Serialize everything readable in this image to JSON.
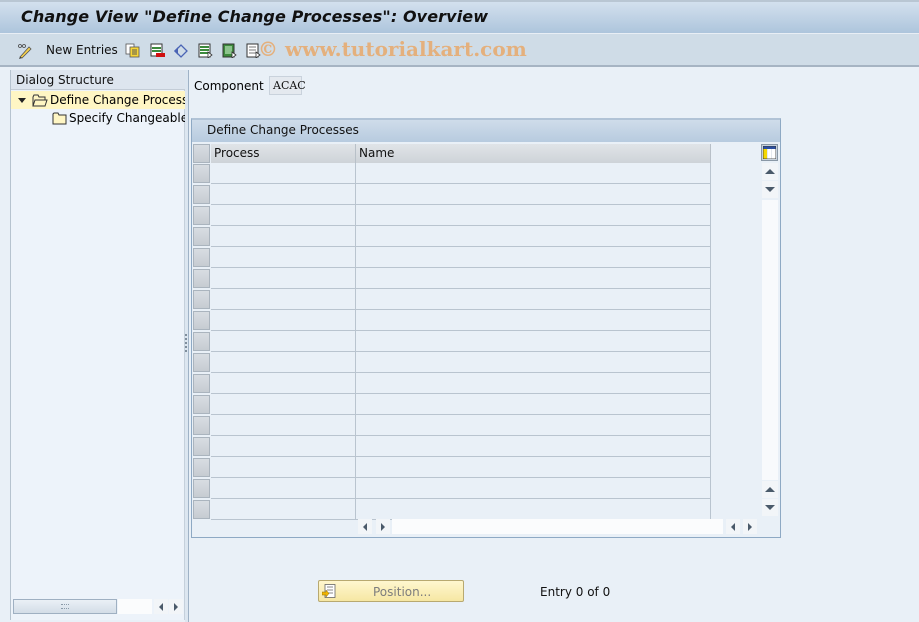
{
  "window": {
    "title": "Change View \"Define Change Processes\": Overview"
  },
  "toolbar": {
    "items": [
      {
        "icon": "display-change-icon",
        "label": ""
      },
      {
        "icon": "new-entries-label",
        "label": "New Entries"
      },
      {
        "icon": "copy-as-icon",
        "label": ""
      },
      {
        "icon": "delete-icon",
        "label": ""
      },
      {
        "icon": "undo-change-icon",
        "label": ""
      },
      {
        "icon": "select-all-icon",
        "label": ""
      },
      {
        "icon": "select-block-icon",
        "label": ""
      },
      {
        "icon": "deselect-all-icon",
        "label": ""
      }
    ],
    "new_entries_label": "New Entries",
    "watermark": "© www.tutorialkart.com"
  },
  "dialog_structure": {
    "header": "Dialog Structure",
    "items": [
      {
        "label": "Define Change Processes",
        "level": 0,
        "expanded": true,
        "selected": true,
        "icon": "open-folder-icon"
      },
      {
        "label": "Specify Changeable Values",
        "level": 1,
        "expanded": false,
        "selected": false,
        "icon": "folder-icon"
      }
    ]
  },
  "component": {
    "label": "Component",
    "value": "ACAC"
  },
  "table": {
    "title": "Define Change Processes",
    "columns": [
      "Process",
      "Name"
    ],
    "rows": [
      [
        "",
        ""
      ],
      [
        "",
        ""
      ],
      [
        "",
        ""
      ],
      [
        "",
        ""
      ],
      [
        "",
        ""
      ],
      [
        "",
        ""
      ],
      [
        "",
        ""
      ],
      [
        "",
        ""
      ],
      [
        "",
        ""
      ],
      [
        "",
        ""
      ],
      [
        "",
        ""
      ],
      [
        "",
        ""
      ],
      [
        "",
        ""
      ],
      [
        "",
        ""
      ],
      [
        "",
        ""
      ],
      [
        "",
        ""
      ],
      [
        "",
        ""
      ]
    ]
  },
  "footer": {
    "position_button": "Position...",
    "entry_text": "Entry 0 of 0"
  },
  "colors": {
    "title_bar": "#adc5dc",
    "toolbar": "#cfdce7",
    "background": "#e9f0f7",
    "selected_tree_item": "#fff6c4",
    "position_button": "#f6e7a3"
  }
}
